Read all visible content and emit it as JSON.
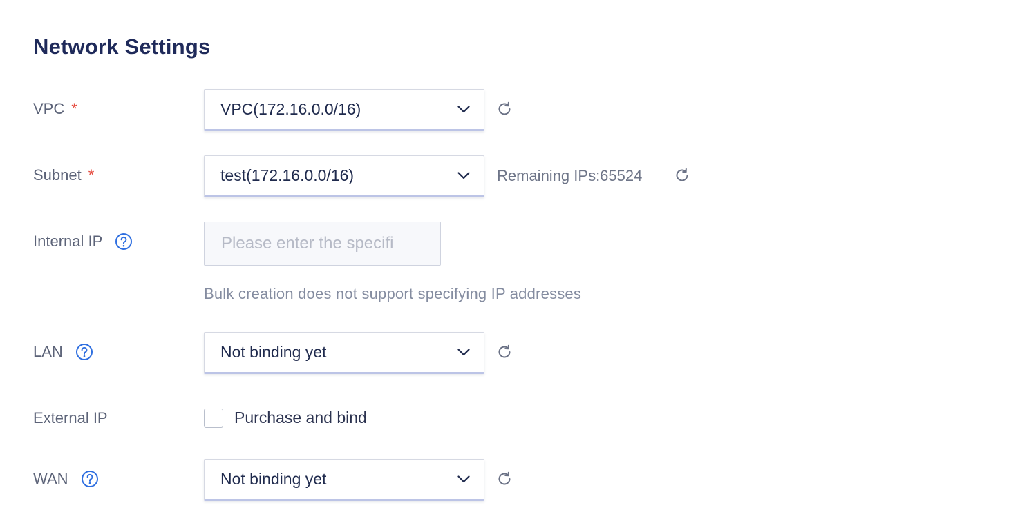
{
  "section": {
    "title": "Network Settings"
  },
  "colors": {
    "required": "#e5483c",
    "help_icon": "#2f6fe0",
    "title": "#1f2a5a"
  },
  "vpc": {
    "label": "VPC",
    "required_mark": "*",
    "value": "VPC(172.16.0.0/16)",
    "refresh_icon": "refresh-icon"
  },
  "subnet": {
    "label": "Subnet",
    "required_mark": "*",
    "value": "test(172.16.0.0/16)",
    "remaining": "Remaining IPs:65524",
    "refresh_icon": "refresh-icon"
  },
  "internal_ip": {
    "label": "Internal IP",
    "help_icon": "help-circle-icon",
    "placeholder": "Please enter the specifi",
    "hint": "Bulk creation does not support specifying IP addresses"
  },
  "lan": {
    "label": "LAN",
    "help_icon": "help-circle-icon",
    "value": "Not binding yet",
    "refresh_icon": "refresh-icon"
  },
  "external_ip": {
    "label": "External IP",
    "checkbox_label": "Purchase and bind",
    "checked": false
  },
  "wan": {
    "label": "WAN",
    "help_icon": "help-circle-icon",
    "value": "Not binding yet",
    "refresh_icon": "refresh-icon"
  }
}
